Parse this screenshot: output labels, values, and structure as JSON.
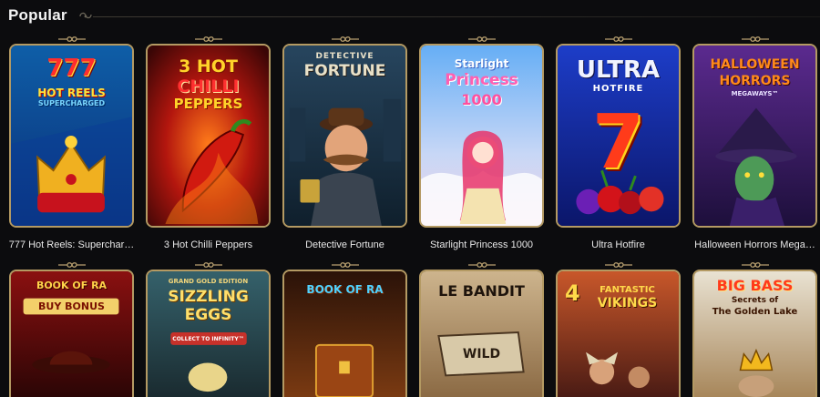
{
  "section": {
    "title": "Popular"
  },
  "row1": [
    {
      "name": "777 Hot Reels: Superchar…",
      "logo_line1": "777",
      "logo_line2": "HOT REELS",
      "logo_line3": "SUPERCHARGED"
    },
    {
      "name": "3 Hot Chilli Peppers",
      "logo_line1": "3 HOT",
      "logo_line2": "CHILLI",
      "logo_line3": "PEPPERS"
    },
    {
      "name": "Detective Fortune",
      "logo_line1": "DETECTIVE",
      "logo_line2": "FORTUNE"
    },
    {
      "name": "Starlight Princess 1000",
      "logo_line1": "Starlight",
      "logo_line2": "Princess",
      "logo_line3": "1000"
    },
    {
      "name": "Ultra Hotfire",
      "logo_line1": "ULTRA",
      "logo_line2": "HOTFIRE",
      "logo_line3": "7"
    },
    {
      "name": "Halloween Horrors Mega…",
      "logo_line1": "HALLOWEEN",
      "logo_line2": "HORRORS",
      "logo_line3": "MEGAWAYS™"
    }
  ],
  "row2": [
    {
      "logo_line1": "BOOK OF RA",
      "logo_line2": "BUY BONUS"
    },
    {
      "logo_line1": "GRAND GOLD EDITION",
      "logo_line2": "SIZZLING",
      "logo_line3": "EGGS",
      "logo_line4": "COLLECT TO INFINITY™"
    },
    {
      "logo_line1": "BOOK OF RA"
    },
    {
      "logo_line1": "LE BANDIT",
      "logo_line2": "WILD"
    },
    {
      "logo_line1": "4",
      "logo_line2": "FANTASTIC",
      "logo_line3": "VIKINGS"
    },
    {
      "logo_line1": "BIG BASS",
      "logo_line2": "Secrets of",
      "logo_line3": "The Golden Lake"
    }
  ]
}
